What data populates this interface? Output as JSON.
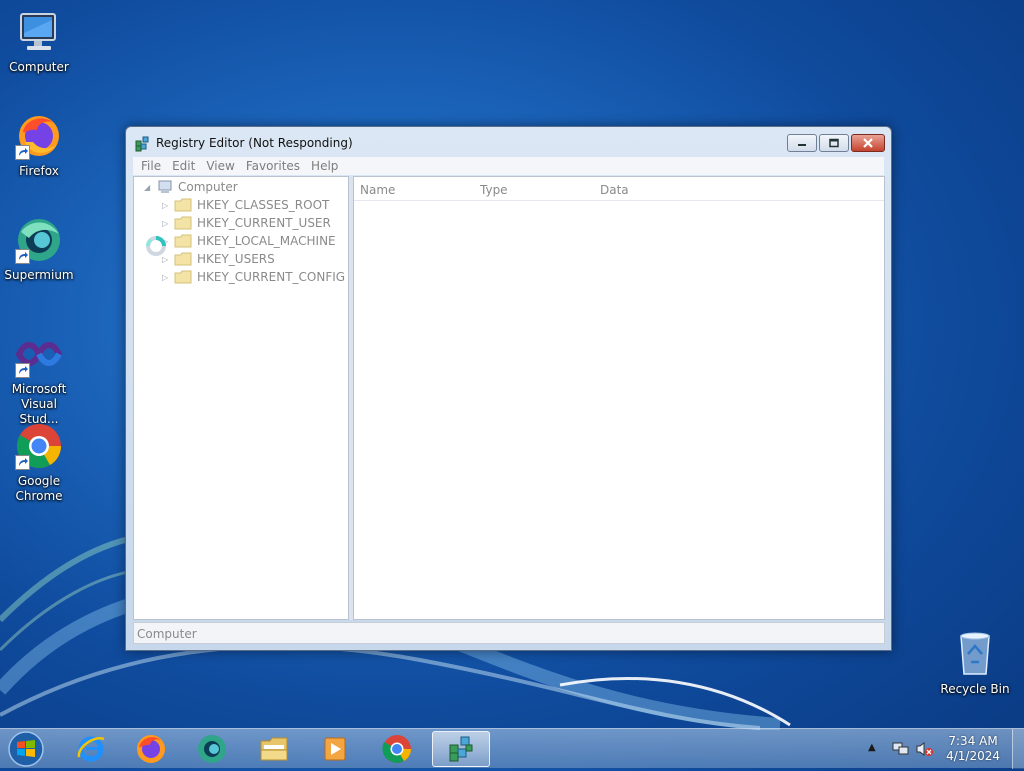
{
  "desktop": {
    "icons": [
      {
        "label": "Computer",
        "icon": "computer-icon"
      },
      {
        "label": "Firefox",
        "icon": "firefox-icon"
      },
      {
        "label": "Supermium",
        "icon": "supermium-icon"
      },
      {
        "label": "Microsoft Visual Stud...",
        "icon": "visual-studio-icon"
      },
      {
        "label": "Google Chrome",
        "icon": "chrome-icon"
      },
      {
        "label": "Recycle Bin",
        "icon": "recycle-bin-icon"
      }
    ]
  },
  "window": {
    "title": "Registry Editor (Not Responding)",
    "menu": [
      "File",
      "Edit",
      "View",
      "Favorites",
      "Help"
    ],
    "tree": {
      "root": "Computer",
      "keys": [
        "HKEY_CLASSES_ROOT",
        "HKEY_CURRENT_USER",
        "HKEY_LOCAL_MACHINE",
        "HKEY_USERS",
        "HKEY_CURRENT_CONFIG"
      ]
    },
    "columns": [
      "Name",
      "Type",
      "Data"
    ],
    "status": "Computer"
  },
  "taskbar": {
    "apps": [
      "internet-explorer-icon",
      "firefox-icon",
      "supermium-icon",
      "file-explorer-icon",
      "media-player-icon",
      "chrome-icon",
      "registry-editor-icon"
    ],
    "clock": {
      "time": "7:34 AM",
      "date": "4/1/2024"
    }
  },
  "colors": {
    "desktop_blue": "#1a62b8",
    "window_frame": "#c7d8ec",
    "close_red": "#c4442f",
    "folder_yellow": "#f1d77e"
  }
}
